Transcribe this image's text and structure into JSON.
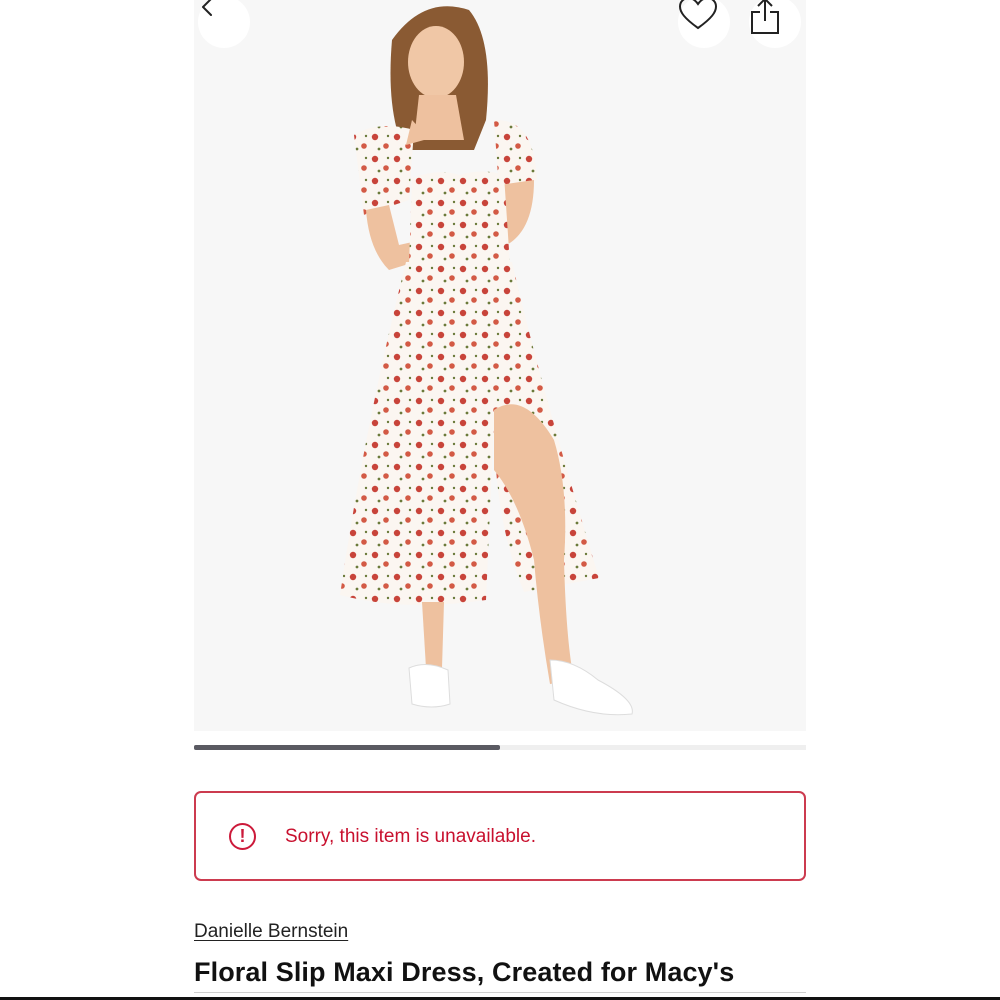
{
  "header": {
    "back_icon": "chevron-left-icon",
    "favorite_icon": "heart-icon",
    "share_icon": "share-icon"
  },
  "gallery": {
    "image_subject": "product-photo-model-wearing-dress",
    "progress_fraction": 0.5
  },
  "alert": {
    "icon": "exclamation-circle-icon",
    "message": "Sorry, this item is unavailable.",
    "color": "#c8102e"
  },
  "product": {
    "brand": "Danielle Bernstein",
    "title": "Floral Slip Maxi Dress, Created for Macy's"
  }
}
